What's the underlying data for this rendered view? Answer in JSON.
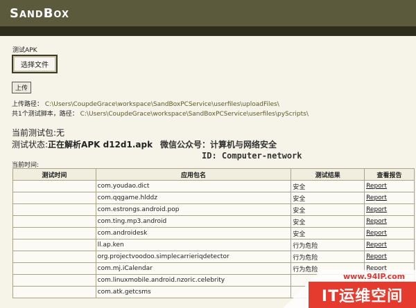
{
  "header": {
    "logo": "SandBox"
  },
  "form": {
    "apk_label": "测试APK",
    "choose_file_label": "选择文件",
    "upload_label": "上传",
    "upload_path_label": "上传路径：",
    "upload_path_value": "C:\\Users\\CoupdeGrace\\workspace\\SandBoxPCService\\userfiles\\uploadFiles\\",
    "scripts_label": "共1个测试脚本，路径：",
    "scripts_path_value": "C:\\Users\\CoupdeGrace\\workspace\\SandBoxPCService\\userfiles\\pyScripts\\"
  },
  "status": {
    "current_pkg": "当前测试包:无",
    "state_label": "测试状态:",
    "state_value": "正在解析APK d12d1.apk",
    "wechat": "微信公众号：计算机与网络安全",
    "id": "ID: Computer-network",
    "current_time": "当前时间:"
  },
  "table": {
    "headers": [
      "测试时间",
      "应用包名",
      "测试结果",
      "查看报告"
    ],
    "rows": [
      {
        "time": "",
        "pkg": "com.youdao.dict",
        "result": "安全",
        "report": "Report"
      },
      {
        "time": "",
        "pkg": "com.qqgame.hlddz",
        "result": "安全",
        "report": "Report"
      },
      {
        "time": "",
        "pkg": "com.estrongs.android.pop",
        "result": "安全",
        "report": "Report"
      },
      {
        "time": "",
        "pkg": "com.ting.mp3.android",
        "result": "安全",
        "report": "Report"
      },
      {
        "time": "",
        "pkg": "com.androidesk",
        "result": "安全",
        "report": "Report"
      },
      {
        "time": "",
        "pkg": "ll.ap.ken",
        "result": "行为危险",
        "report": "Report"
      },
      {
        "time": "",
        "pkg": "org.projectvoodoo.simplecarrieriqdetector",
        "result": "行为危险",
        "report": "Report"
      },
      {
        "time": "",
        "pkg": "com.mj.iCalendar",
        "result": "行为危险",
        "report": "Report"
      },
      {
        "time": "",
        "pkg": "com.linuxmobile.android.nzoric.celebrity",
        "result": "",
        "report": ""
      },
      {
        "time": "",
        "pkg": "com.atk.getcsms",
        "result": "",
        "report": ""
      }
    ]
  },
  "watermark": {
    "url": "www.94IP.com",
    "text": "IT运维空间"
  }
}
